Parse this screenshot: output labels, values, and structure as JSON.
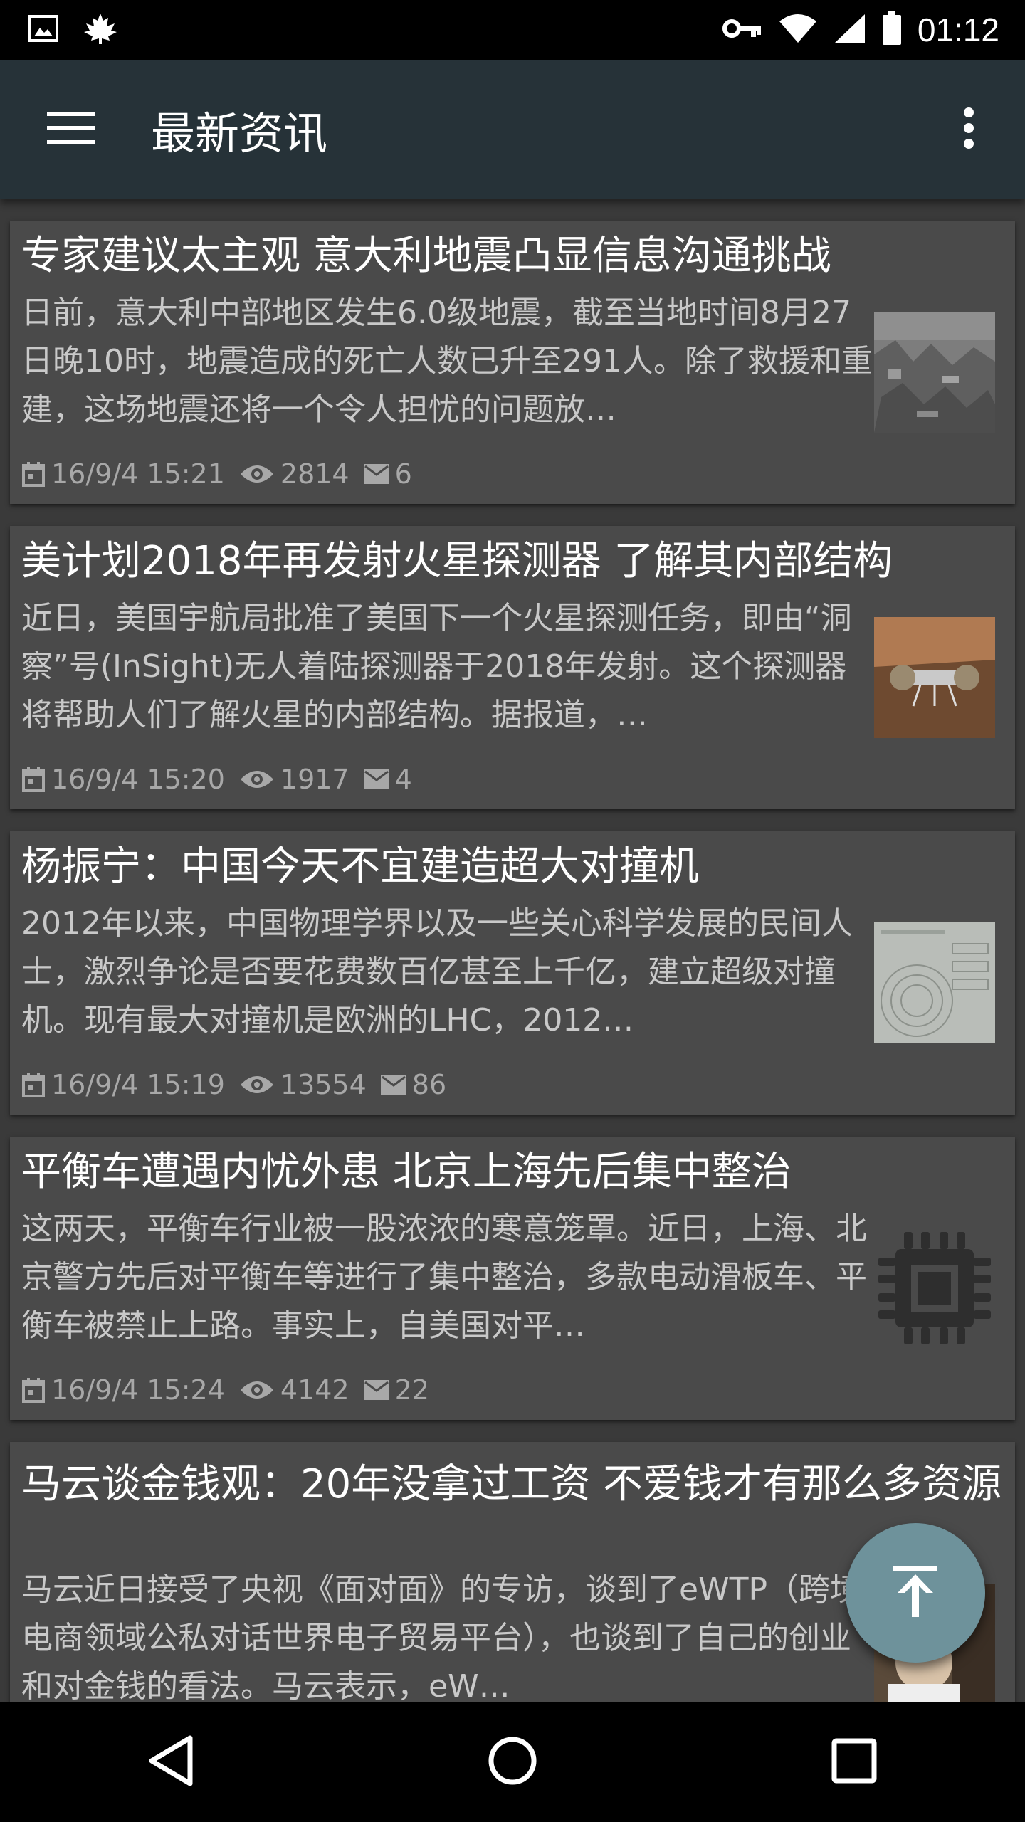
{
  "status_bar": {
    "time": "01:12",
    "icons": [
      "image-icon",
      "maple-leaf-icon",
      "vpn-key-icon",
      "wifi-icon",
      "signal-icon",
      "battery-icon"
    ]
  },
  "app_bar": {
    "title": "最新资讯",
    "menu_icon": "hamburger-menu-icon",
    "overflow_icon": "more-vert-icon",
    "background": "#263238"
  },
  "articles": [
    {
      "title": "专家建议太主观 意大利地震凸显信息沟通挑战",
      "summary": "日前，意大利中部地区发生6.0级地震，截至当地时间8月27日晚10时，地震造成的死亡人数已升至291人。除了救援和重建，这场地震还将一个令人担忧的问题放…",
      "date": "16/9/4 15:21",
      "views": "2814",
      "comments": "6",
      "thumbnail": "earthquake-rubble-photo"
    },
    {
      "title": "美计划2018年再发射火星探测器 了解其内部结构",
      "summary": "近日，美国宇航局批准了美国下一个火星探测任务，即由“洞察”号(InSight)无人着陆探测器于2018年发射。这个探测器将帮助人们了解火星的内部结构。据报道，…",
      "date": "16/9/4 15:20",
      "views": "1917",
      "comments": "4",
      "thumbnail": "mars-lander-photo"
    },
    {
      "title": "杨振宁：中国今天不宜建造超大对撞机",
      "summary": "2012年以来，中国物理学界以及一些关心科学发展的民间人士，激烈争论是否要花费数百亿甚至上千亿，建立超级对撞机。现有最大对撞机是欧洲的LHC，2012…",
      "date": "16/9/4 15:19",
      "views": "13554",
      "comments": "86",
      "thumbnail": "collider-diagram-image"
    },
    {
      "title": "平衡车遭遇内忧外患 北京上海先后集中整治",
      "summary": "这两天，平衡车行业被一股浓浓的寒意笼罩。近日，上海、北京警方先后对平衡车等进行了集中整治，多款电动滑板车、平衡车被禁止上路。事实上，自美国对平…",
      "date": "16/9/4 15:24",
      "views": "4142",
      "comments": "22",
      "thumbnail": "chip-placeholder-icon"
    },
    {
      "title": "马云谈金钱观：20年没拿过工资 不爱钱才有那么多资源",
      "summary": "马云近日接受了央视《面对面》的专访，谈到了eWTP（跨境电商领域公私对话世界电子贸易平台），也谈到了自己的创业和对金钱的看法。马云表示，eW…",
      "thumbnail": "interview-photo"
    }
  ],
  "fab": {
    "icon": "scroll-to-top-icon",
    "color": "#6e929b"
  },
  "nav_bar": {
    "icons": [
      "back-icon",
      "home-icon",
      "recents-icon"
    ]
  }
}
